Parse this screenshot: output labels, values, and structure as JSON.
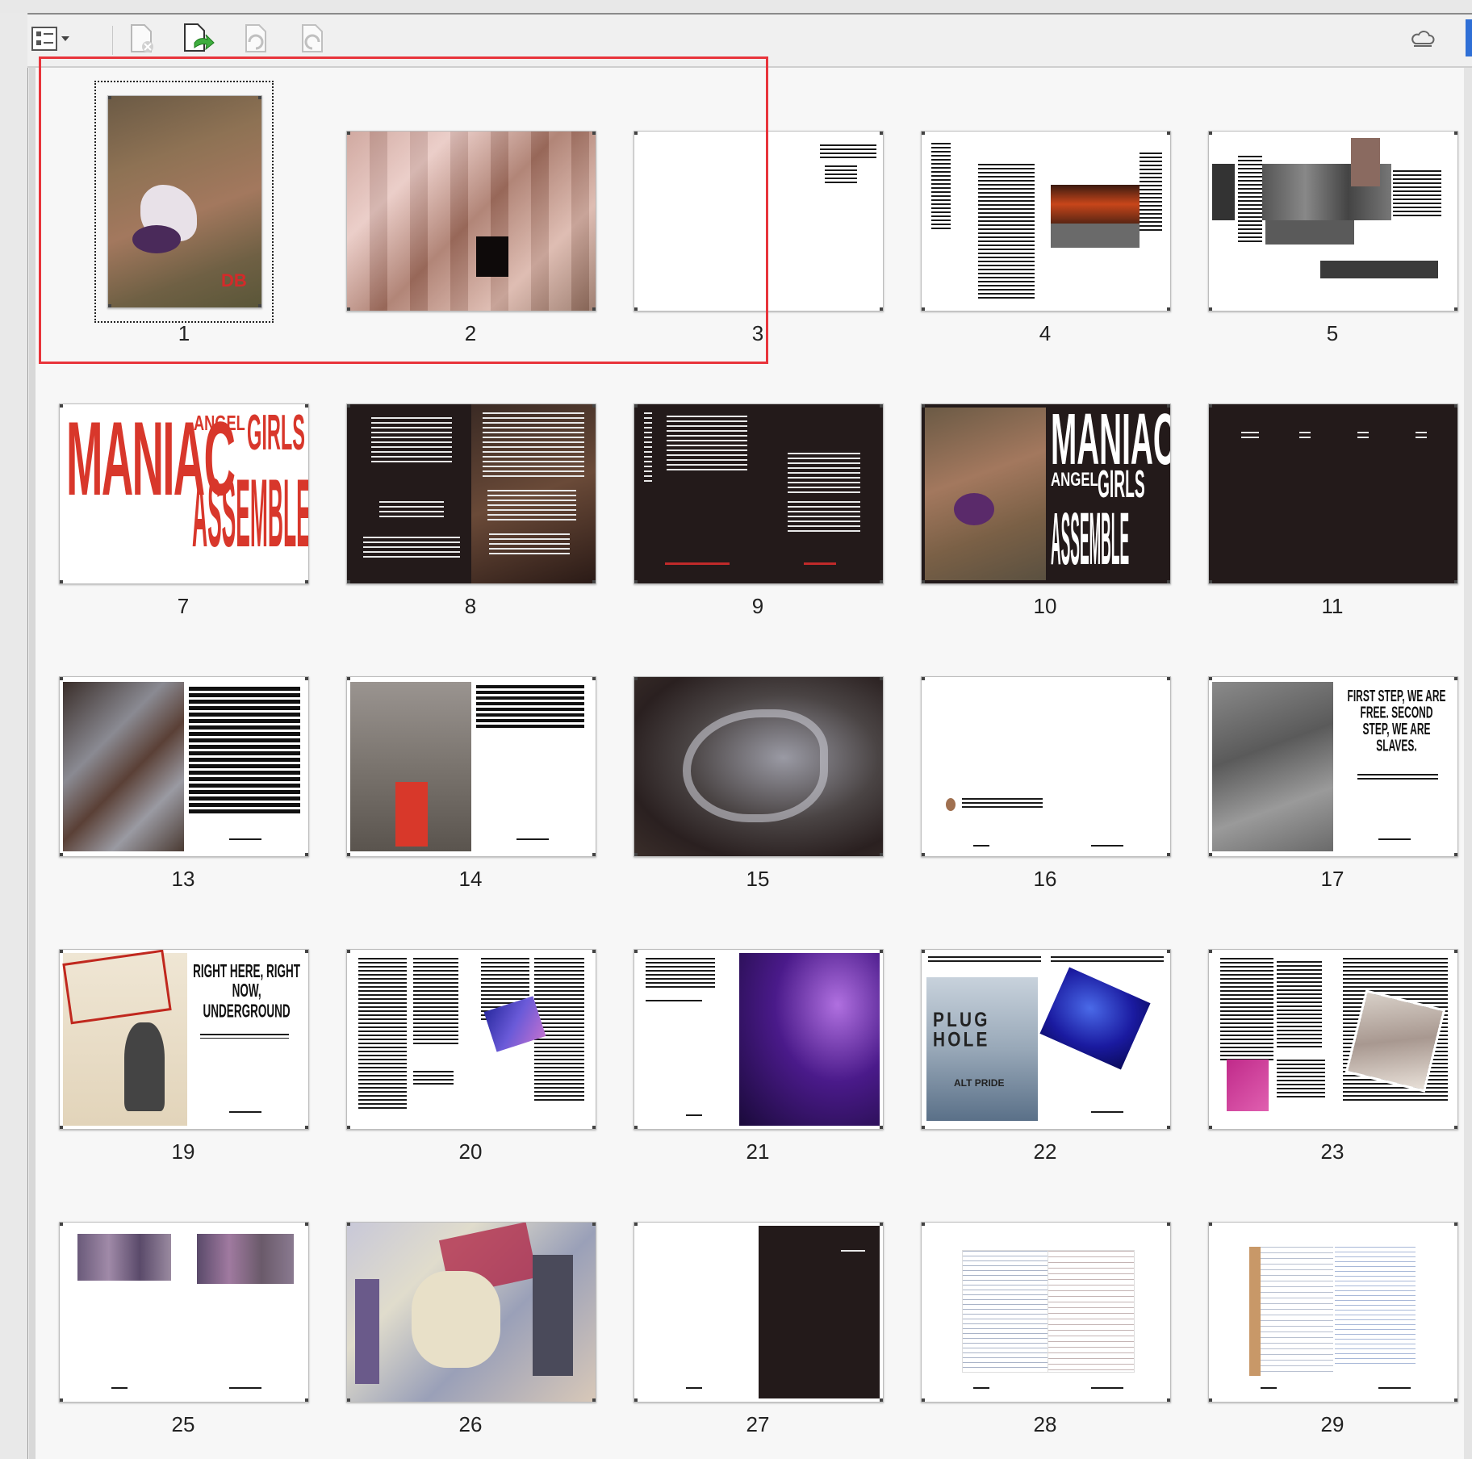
{
  "toolbar": {
    "buttons": [
      {
        "icon": "thumbnail-options-icon",
        "has_dropdown": true
      },
      {
        "icon": "delete-page-icon"
      },
      {
        "icon": "insert-page-icon"
      },
      {
        "icon": "rotate-ccw-icon"
      },
      {
        "icon": "rotate-cw-icon"
      }
    ],
    "right_icon": "cloud-icon"
  },
  "thumbnails": [
    {
      "page": "1"
    },
    {
      "page": "2"
    },
    {
      "page": "3"
    },
    {
      "page": "4"
    },
    {
      "page": "5"
    },
    {
      "page": "7"
    },
    {
      "page": "8"
    },
    {
      "page": "9"
    },
    {
      "page": "10"
    },
    {
      "page": "11"
    },
    {
      "page": "13"
    },
    {
      "page": "14"
    },
    {
      "page": "15"
    },
    {
      "page": "16"
    },
    {
      "page": "17"
    },
    {
      "page": "19"
    },
    {
      "page": "20"
    },
    {
      "page": "21"
    },
    {
      "page": "22"
    },
    {
      "page": "23"
    },
    {
      "page": "25"
    },
    {
      "page": "26"
    },
    {
      "page": "27"
    },
    {
      "page": "28"
    },
    {
      "page": "29"
    }
  ],
  "page_text": {
    "p1_badge": "DB",
    "p7_maniac": "MANIAC",
    "p7_angel": "ANGEL",
    "p7_girls": "GIRLS",
    "p7_assemble": "ASSEMBLE",
    "p10_maniac": "MANIAC",
    "p10_angel": "ANGEL",
    "p10_girls": "GIRLS",
    "p10_assemble": "ASSEMBLE",
    "p17_heading": "FIRST STEP, WE ARE FREE. SECOND STEP, WE ARE SLAVES.",
    "p19_heading": "RIGHT HERE, RIGHT NOW, UNDERGROUND",
    "p22_title": "PLUG HOLE",
    "p22_sub": "ALT PRIDE"
  },
  "selection_color": "#e8343b"
}
